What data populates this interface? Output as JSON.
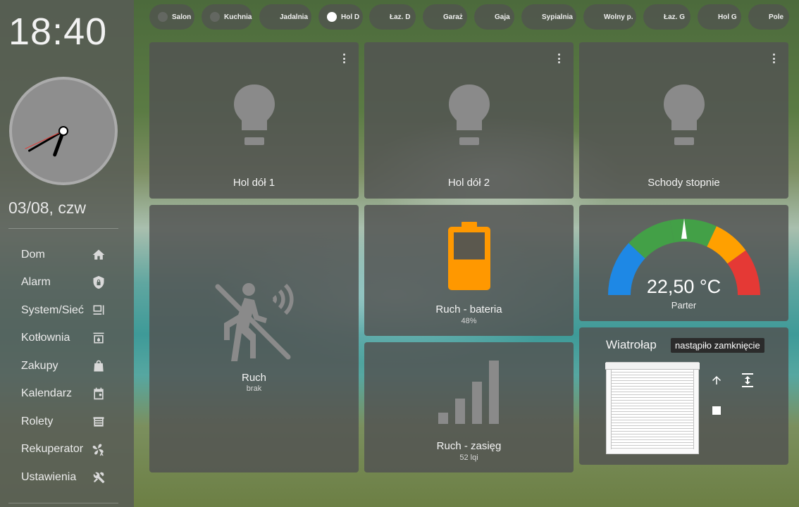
{
  "sidebar": {
    "time": "18:40",
    "date": "03/08, czw",
    "clock": {
      "hour": 18,
      "minute": 40
    },
    "items": [
      {
        "label": "Dom",
        "icon": "home-icon"
      },
      {
        "label": "Alarm",
        "icon": "shield-lock-icon"
      },
      {
        "label": "System/Sieć",
        "icon": "desktop-tower-icon"
      },
      {
        "label": "Kotłownia",
        "icon": "water-boiler-icon"
      },
      {
        "label": "Zakupy",
        "icon": "shopping-bag-icon"
      },
      {
        "label": "Kalendarz",
        "icon": "calendar-icon"
      },
      {
        "label": "Rolety",
        "icon": "window-shutter-icon"
      },
      {
        "label": "Rekuperator",
        "icon": "fan-auto-icon"
      },
      {
        "label": "Ustawienia",
        "icon": "tools-icon"
      }
    ]
  },
  "rooms": [
    {
      "label": "Salon",
      "active": false
    },
    {
      "label": "Kuchnia",
      "active": false
    },
    {
      "label": "Jadalnia",
      "active": false
    },
    {
      "label": "Hol D",
      "active": true
    },
    {
      "label": "Łaz. D",
      "active": false
    },
    {
      "label": "Garaż",
      "active": false
    },
    {
      "label": "Gaja",
      "active": false
    },
    {
      "label": "Sypialnia",
      "active": false
    },
    {
      "label": "Wolny p.",
      "active": false
    },
    {
      "label": "Łaz. G",
      "active": false
    },
    {
      "label": "Hol G",
      "active": false
    },
    {
      "label": "Pole",
      "active": false
    }
  ],
  "lights": [
    {
      "name": "Hol dół 1",
      "state": "off"
    },
    {
      "name": "Hol dół 2",
      "state": "off"
    },
    {
      "name": "Schody stopnie",
      "state": "off"
    }
  ],
  "motion": {
    "name": "Ruch",
    "state": "brak",
    "icon": "motion-sensor-off-icon"
  },
  "battery": {
    "name": "Ruch - bateria",
    "value": "48%",
    "level": 0.48,
    "color": "#ff9800",
    "icon": "battery-icon"
  },
  "signal": {
    "name": "Ruch - zasięg",
    "value": "52 lqi",
    "icon": "signal-bars-icon"
  },
  "gauge": {
    "value_text": "22,50 °C",
    "name": "Parter",
    "value": 22.5,
    "min": 10,
    "max": 35,
    "segments": [
      {
        "from": 10,
        "to": 16,
        "color": "#1e88e5"
      },
      {
        "from": 16,
        "to": 21,
        "color": "#43a047"
      },
      {
        "from": 21,
        "to": 26,
        "color": "#43a047"
      },
      {
        "from": 26,
        "to": 30,
        "color": "#ffa000"
      },
      {
        "from": 30,
        "to": 35,
        "color": "#e53935"
      }
    ]
  },
  "cover": {
    "name": "Wiatrołap",
    "status": "nastąpiło zamknięcie",
    "position": 0,
    "icons": [
      "arrow-up-icon",
      "stop-icon",
      "set-position-icon"
    ]
  }
}
